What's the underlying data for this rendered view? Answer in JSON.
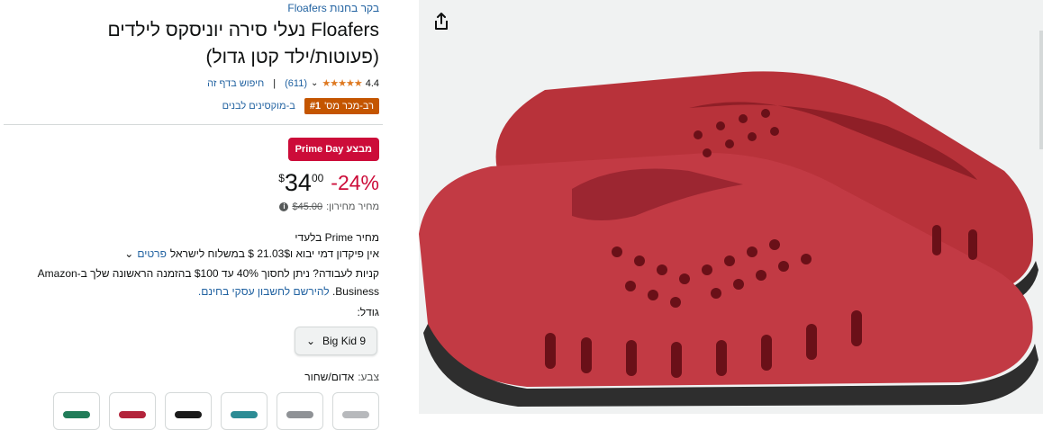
{
  "store_link": "בקר בחנות Floafers",
  "title": "Floafers נעלי סירה יוניסקס לילדים (פעוטות/ילד קטן גדול)",
  "rating": {
    "value": "4.4",
    "stars": "★★★★★",
    "count": "(611)",
    "separator": "|",
    "search_link": "חיפוש בדף זה"
  },
  "bestseller": {
    "rank": "#1",
    "label": "רב-מכר מס'",
    "category": "ב-מוקסינים לבנים"
  },
  "deal_badge": "מבצע Prime Day",
  "price": {
    "discount": "-24%",
    "currency": "$",
    "whole": "34",
    "fraction": "00",
    "list_label": "מחיר מחירון:",
    "list_value": "$45.00"
  },
  "prime_price_label": "מחיר Prime בלעדי",
  "shipping": {
    "text": "אין פיקדון דמי יבוא ו21.03$ $ במשלוח לישראל",
    "details_link": "פרטים"
  },
  "business": {
    "text": "קניות לעבודה? ניתן לחסוך 40% עד $100 בהזמנה הראשונה שלך ב-Amazon Business.",
    "link": "להירשם לחשבון עסקי בחינם."
  },
  "size": {
    "label": "גודל:",
    "selected": "Big Kid 9"
  },
  "color": {
    "label": "צבע:",
    "value": "אדום/שחור",
    "swatches": [
      "#b7b9bc",
      "#8f9296",
      "#2c8c95",
      "#1a1a1a",
      "#b3243b",
      "#217c59"
    ]
  },
  "icons": {
    "share": "share-icon",
    "info": "info-icon",
    "chevron": "chevron-down-icon"
  },
  "colors": {
    "link": "#2162a1",
    "deal": "#cc0c39",
    "bestseller": "#c45500",
    "star": "#de7921"
  }
}
